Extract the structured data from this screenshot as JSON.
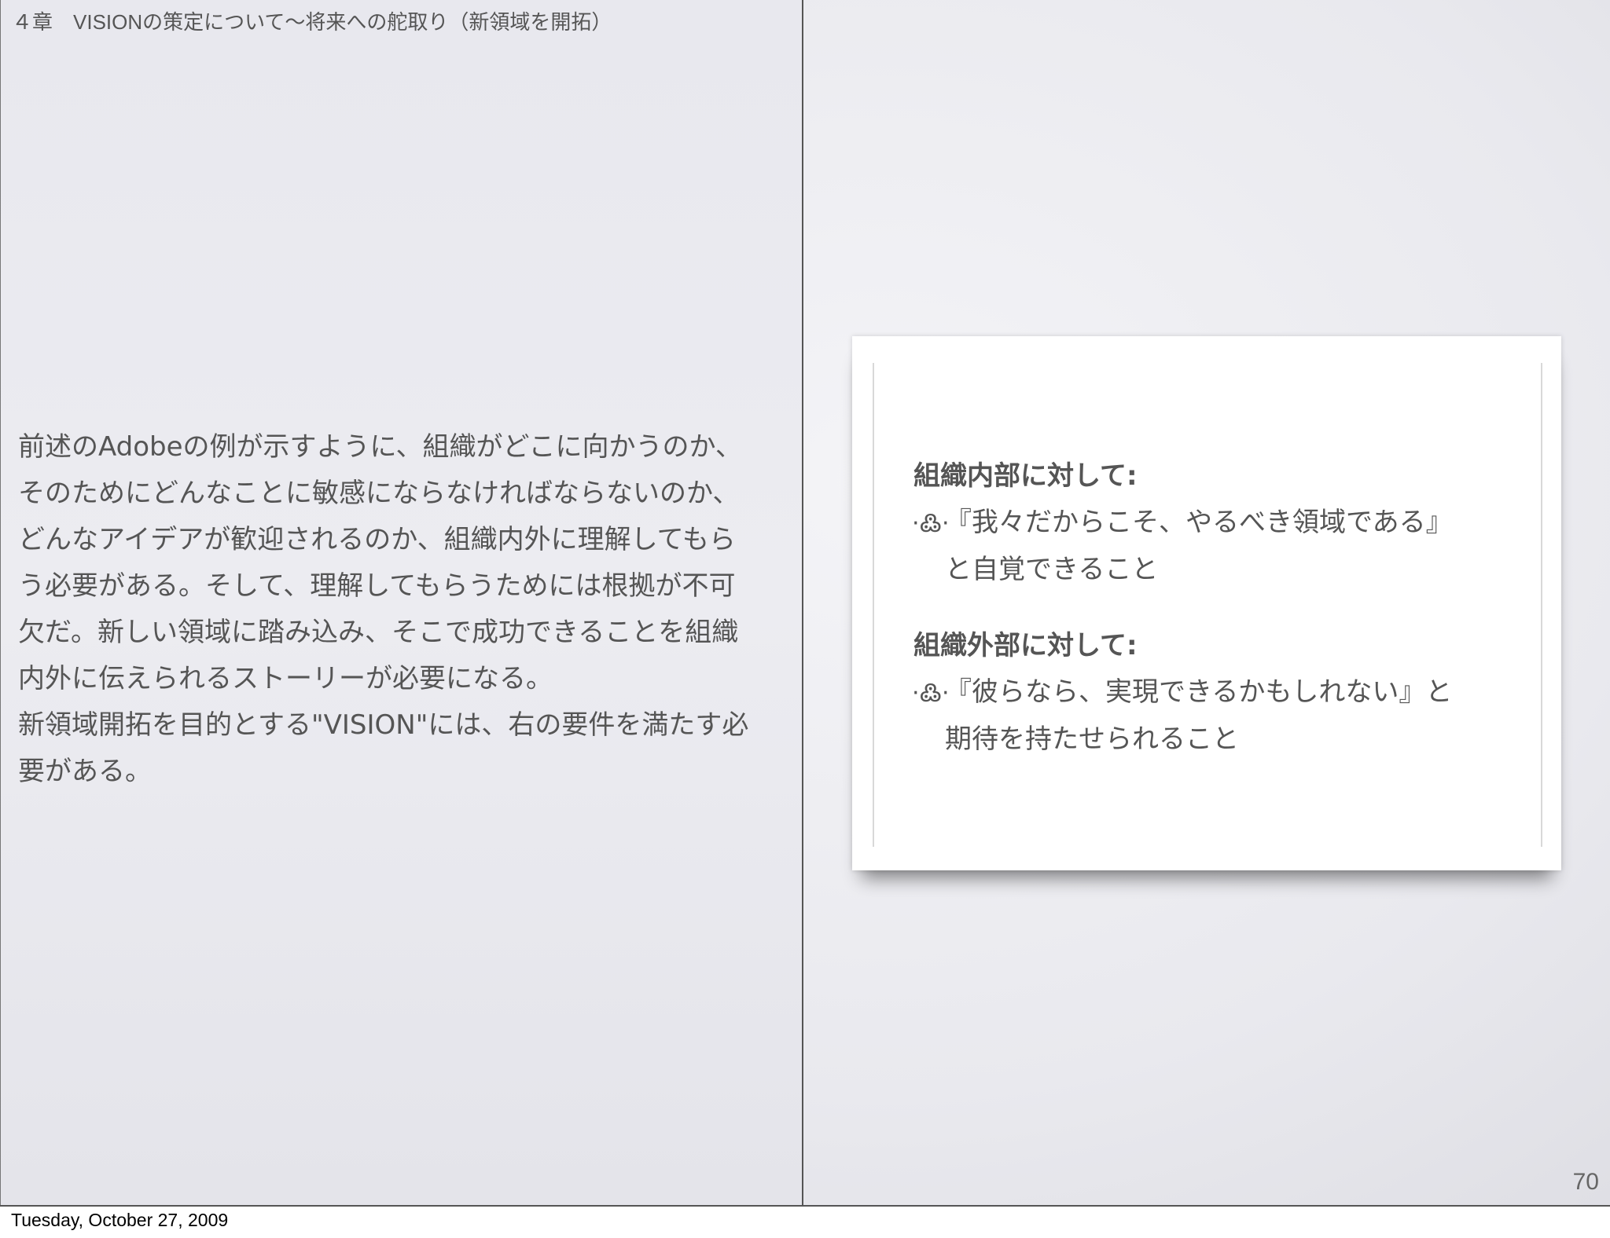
{
  "header": {
    "chapter": "４章　VISIONの策定について〜将来への舵取り（新領域を開拓）"
  },
  "left": {
    "paragraph_lines": [
      "前述のAdobeの例が示すように、組織がどこに向かうのか、",
      "そのためにどんなことに敏感にならなければならないのか、",
      "どんなアイデアが歓迎されるのか、組織内外に理解してもら",
      "う必要がある。そして、理解してもらうためには根拠が不可",
      "欠だ。新しい領域に踏み込み、そこで成功できることを組織",
      "内外に伝えられるストーリーが必要になる。",
      "新領域開拓を目的とする\"VISION\"には、右の要件を満たす必",
      "要がある。"
    ]
  },
  "card": {
    "internal": {
      "title": "組織内部に対して:",
      "bullet_line1": "『我々だからこそ、やるべき領域である』",
      "bullet_line2": "と自覚できること"
    },
    "external": {
      "title": "組織外部に対して:",
      "bullet_line1": "『彼らなら、実現できるかもしれない』と",
      "bullet_line2": "期待を持たせられること"
    },
    "bullet_glyph": "·߷·"
  },
  "footer": {
    "page_number": "70",
    "date": "Tuesday, October 27, 2009"
  }
}
